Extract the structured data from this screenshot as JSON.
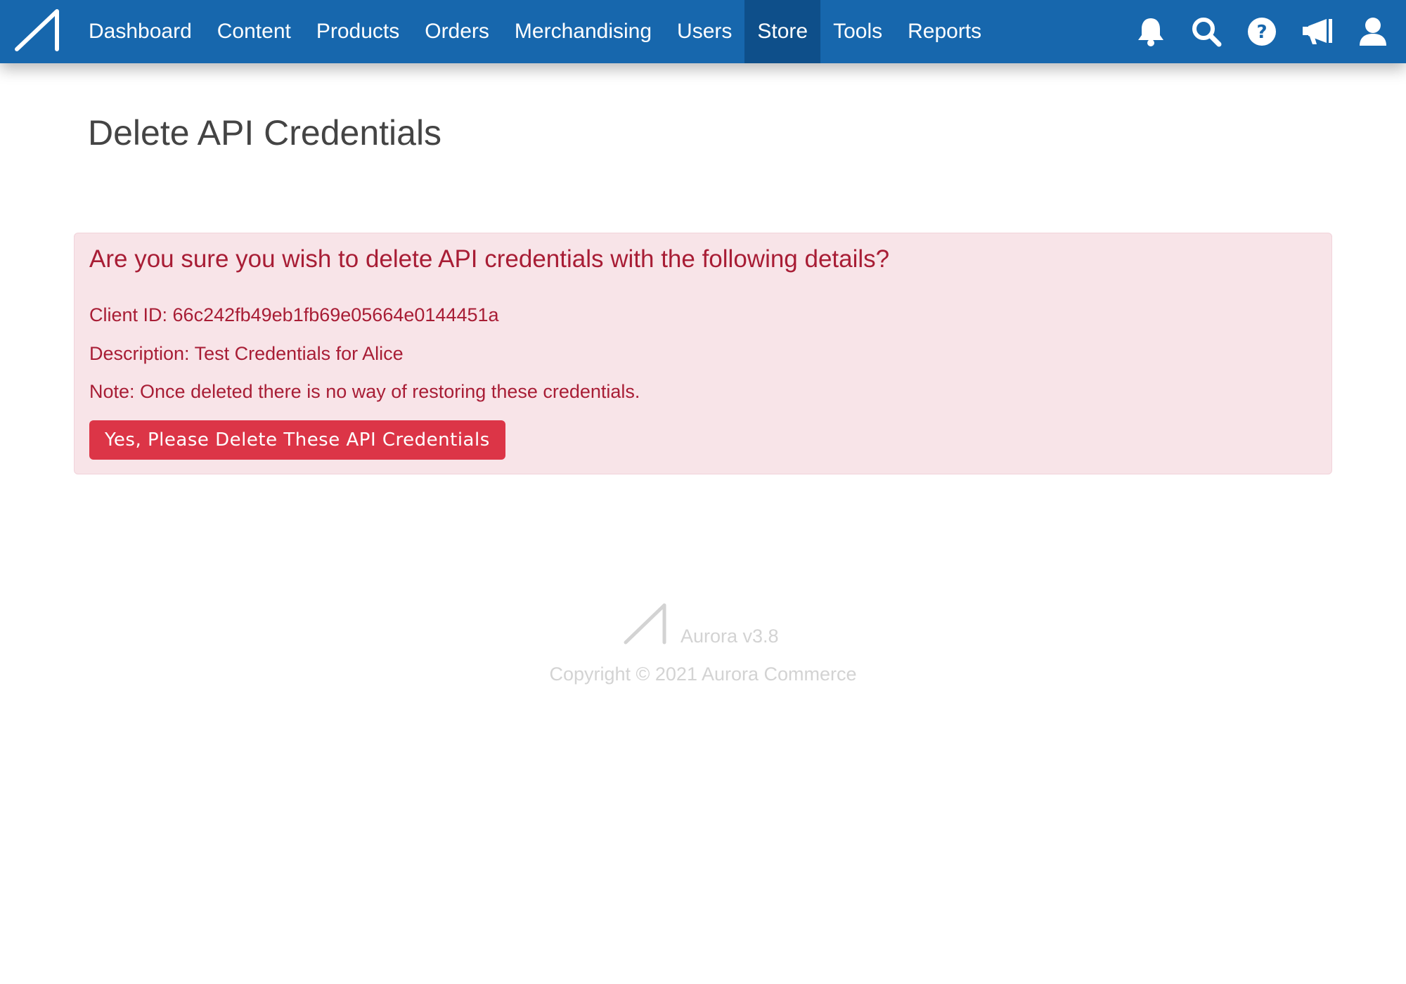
{
  "nav": {
    "items": [
      {
        "label": "Dashboard",
        "active": false
      },
      {
        "label": "Content",
        "active": false
      },
      {
        "label": "Products",
        "active": false
      },
      {
        "label": "Orders",
        "active": false
      },
      {
        "label": "Merchandising",
        "active": false
      },
      {
        "label": "Users",
        "active": false
      },
      {
        "label": "Store",
        "active": true
      },
      {
        "label": "Tools",
        "active": false
      },
      {
        "label": "Reports",
        "active": false
      }
    ],
    "icons": [
      "bell-icon",
      "search-icon",
      "help-icon",
      "megaphone-icon",
      "user-icon"
    ]
  },
  "page": {
    "title": "Delete API Credentials"
  },
  "alert": {
    "heading": "Are you sure you wish to delete API credentials with the following details?",
    "client_id_line": "Client ID: 66c242fb49eb1fb69e05664e0144451a",
    "description_line": "Description: Test Credentials for Alice",
    "note_line": "Note: Once deleted there is no way of restoring these credentials.",
    "button_label": "Yes, Please Delete These API Credentials"
  },
  "footer": {
    "version": "Aurora v3.8",
    "copyright": "Copyright © 2021 Aurora Commerce"
  },
  "colors": {
    "nav_background": "#1767ad",
    "nav_active": "#0e4f8a",
    "alert_background": "#f8e4e8",
    "alert_text": "#a81d35",
    "danger_button": "#dc3547"
  }
}
